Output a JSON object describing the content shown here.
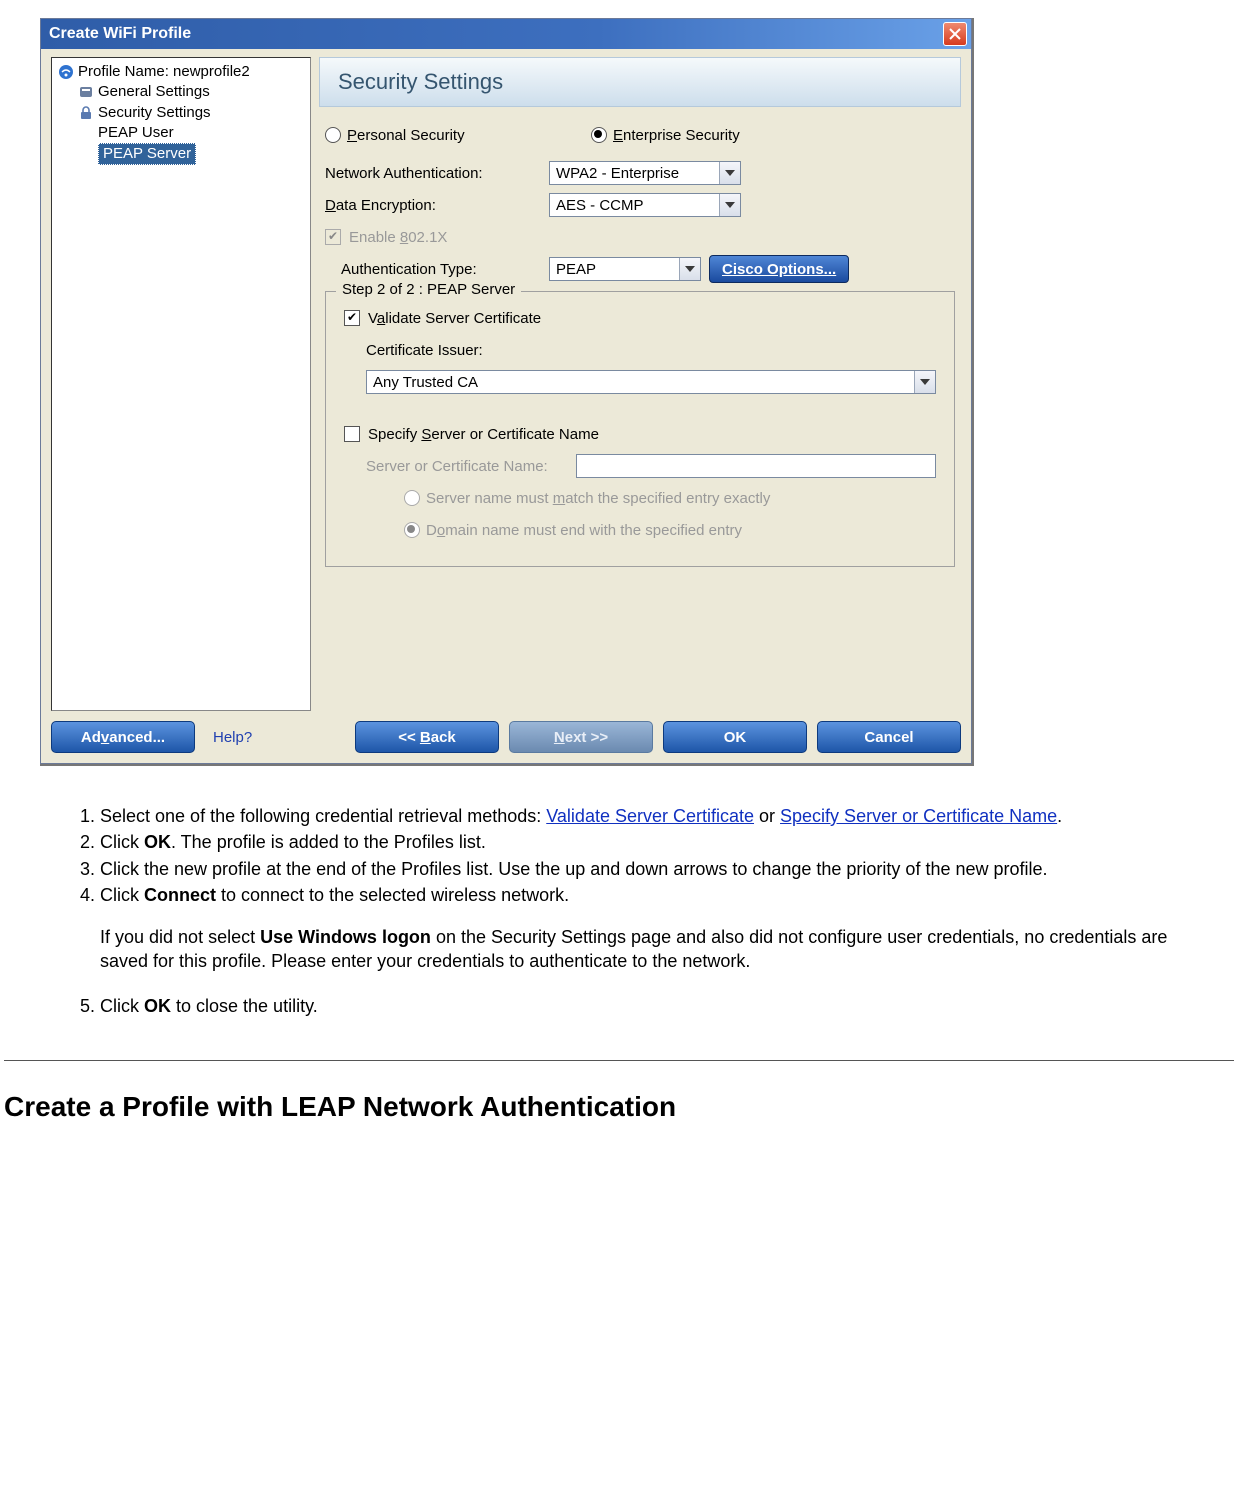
{
  "dialog": {
    "title": "Create WiFi Profile",
    "tree": {
      "profile_label": "Profile Name: newprofile2",
      "general": "General Settings",
      "security": "Security Settings",
      "peap_user": "PEAP User",
      "peap_server": "PEAP Server"
    },
    "pane_title": "Security Settings",
    "radios": {
      "personal": "Personal Security",
      "enterprise": "Enterprise Security",
      "selected": "enterprise"
    },
    "net_auth": {
      "label": "Network Authentication:",
      "value": "WPA2 - Enterprise"
    },
    "data_enc": {
      "label": "Data Encryption:",
      "value": "AES - CCMP"
    },
    "enable_8021x": "Enable 802.1X",
    "auth_type": {
      "label": "Authentication Type:",
      "value": "PEAP"
    },
    "cisco_options": "Cisco Options...",
    "group": {
      "legend": "Step 2 of 2 : PEAP Server",
      "validate": "Validate Server Certificate",
      "cert_issuer_label": "Certificate Issuer:",
      "cert_issuer_value": "Any Trusted CA",
      "specify": "Specify Server or Certificate Name",
      "server_name_label": "Server or Certificate Name:",
      "match_exact": "Server name must match the specified entry exactly",
      "match_suffix": "Domain name must end with the specified entry"
    },
    "footer": {
      "advanced": "Advanced...",
      "help": "Help?",
      "back": "<< Back",
      "next": "Next >>",
      "ok": "OK",
      "cancel": "Cancel"
    }
  },
  "instructions": {
    "items": {
      "i1a": "Select one of the following credential retrieval methods: ",
      "i1_link1": "Validate Server Certificate",
      "i1b": " or ",
      "i1_link2": "Specify Server or Certificate Name",
      "i1c": ".",
      "i2a": "Click ",
      "i2b": "OK",
      "i2c": ". The profile is added to the Profiles list.",
      "i3": "Click the new profile at the end of the Profiles list. Use the up and down arrows to change the priority of the new profile.",
      "i4a": "Click ",
      "i4b": "Connect",
      "i4c": " to connect to the selected wireless network.",
      "i4p1": "If you did not select ",
      "i4p2": "Use Windows logon",
      "i4p3": " on the Security Settings page and also did not configure user credentials, no credentials are saved for this profile. Please enter your credentials to authenticate to the network.",
      "i5a": "Click ",
      "i5b": "OK",
      "i5c": " to close the utility."
    }
  },
  "section_heading": "Create a Profile with LEAP Network Authentication"
}
